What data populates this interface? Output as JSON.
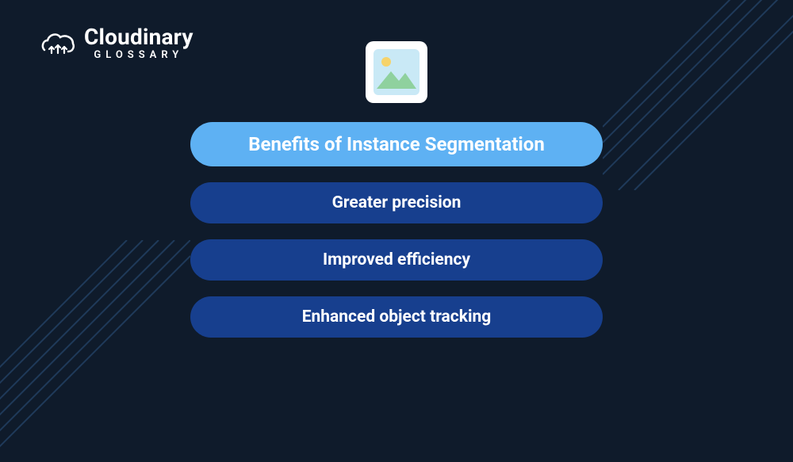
{
  "brand": {
    "name": "Cloudinary",
    "subtitle": "GLOSSARY"
  },
  "title": "Benefits of Instance Segmentation",
  "items": [
    "Greater precision",
    "Improved efficiency",
    "Enhanced object tracking"
  ],
  "colors": {
    "background": "#0f1b2b",
    "title_pill": "#5eb1f3",
    "item_pill": "#173f8e",
    "accent_lines": "#1f3a5a"
  }
}
